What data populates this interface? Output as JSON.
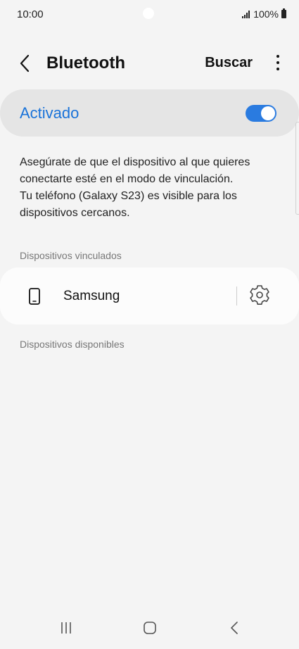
{
  "status_bar": {
    "time": "10:00",
    "battery": "100%"
  },
  "header": {
    "title": "Bluetooth",
    "search_label": "Buscar"
  },
  "bluetooth_toggle": {
    "label": "Activado",
    "state": "on",
    "accent_color": "#2a7be0"
  },
  "info": {
    "lines": [
      "Asegúrate de que el dispositivo al que quieres",
      "conectarte esté en el modo de vinculación.",
      "Tu teléfono (Galaxy S23) es visible para los",
      "dispositivos cercanos."
    ]
  },
  "paired_section": {
    "header": "Dispositivos vinculados",
    "devices": [
      {
        "name": "Samsung",
        "icon": "phone-icon"
      }
    ]
  },
  "available_section": {
    "header": "Dispositivos disponibles"
  }
}
